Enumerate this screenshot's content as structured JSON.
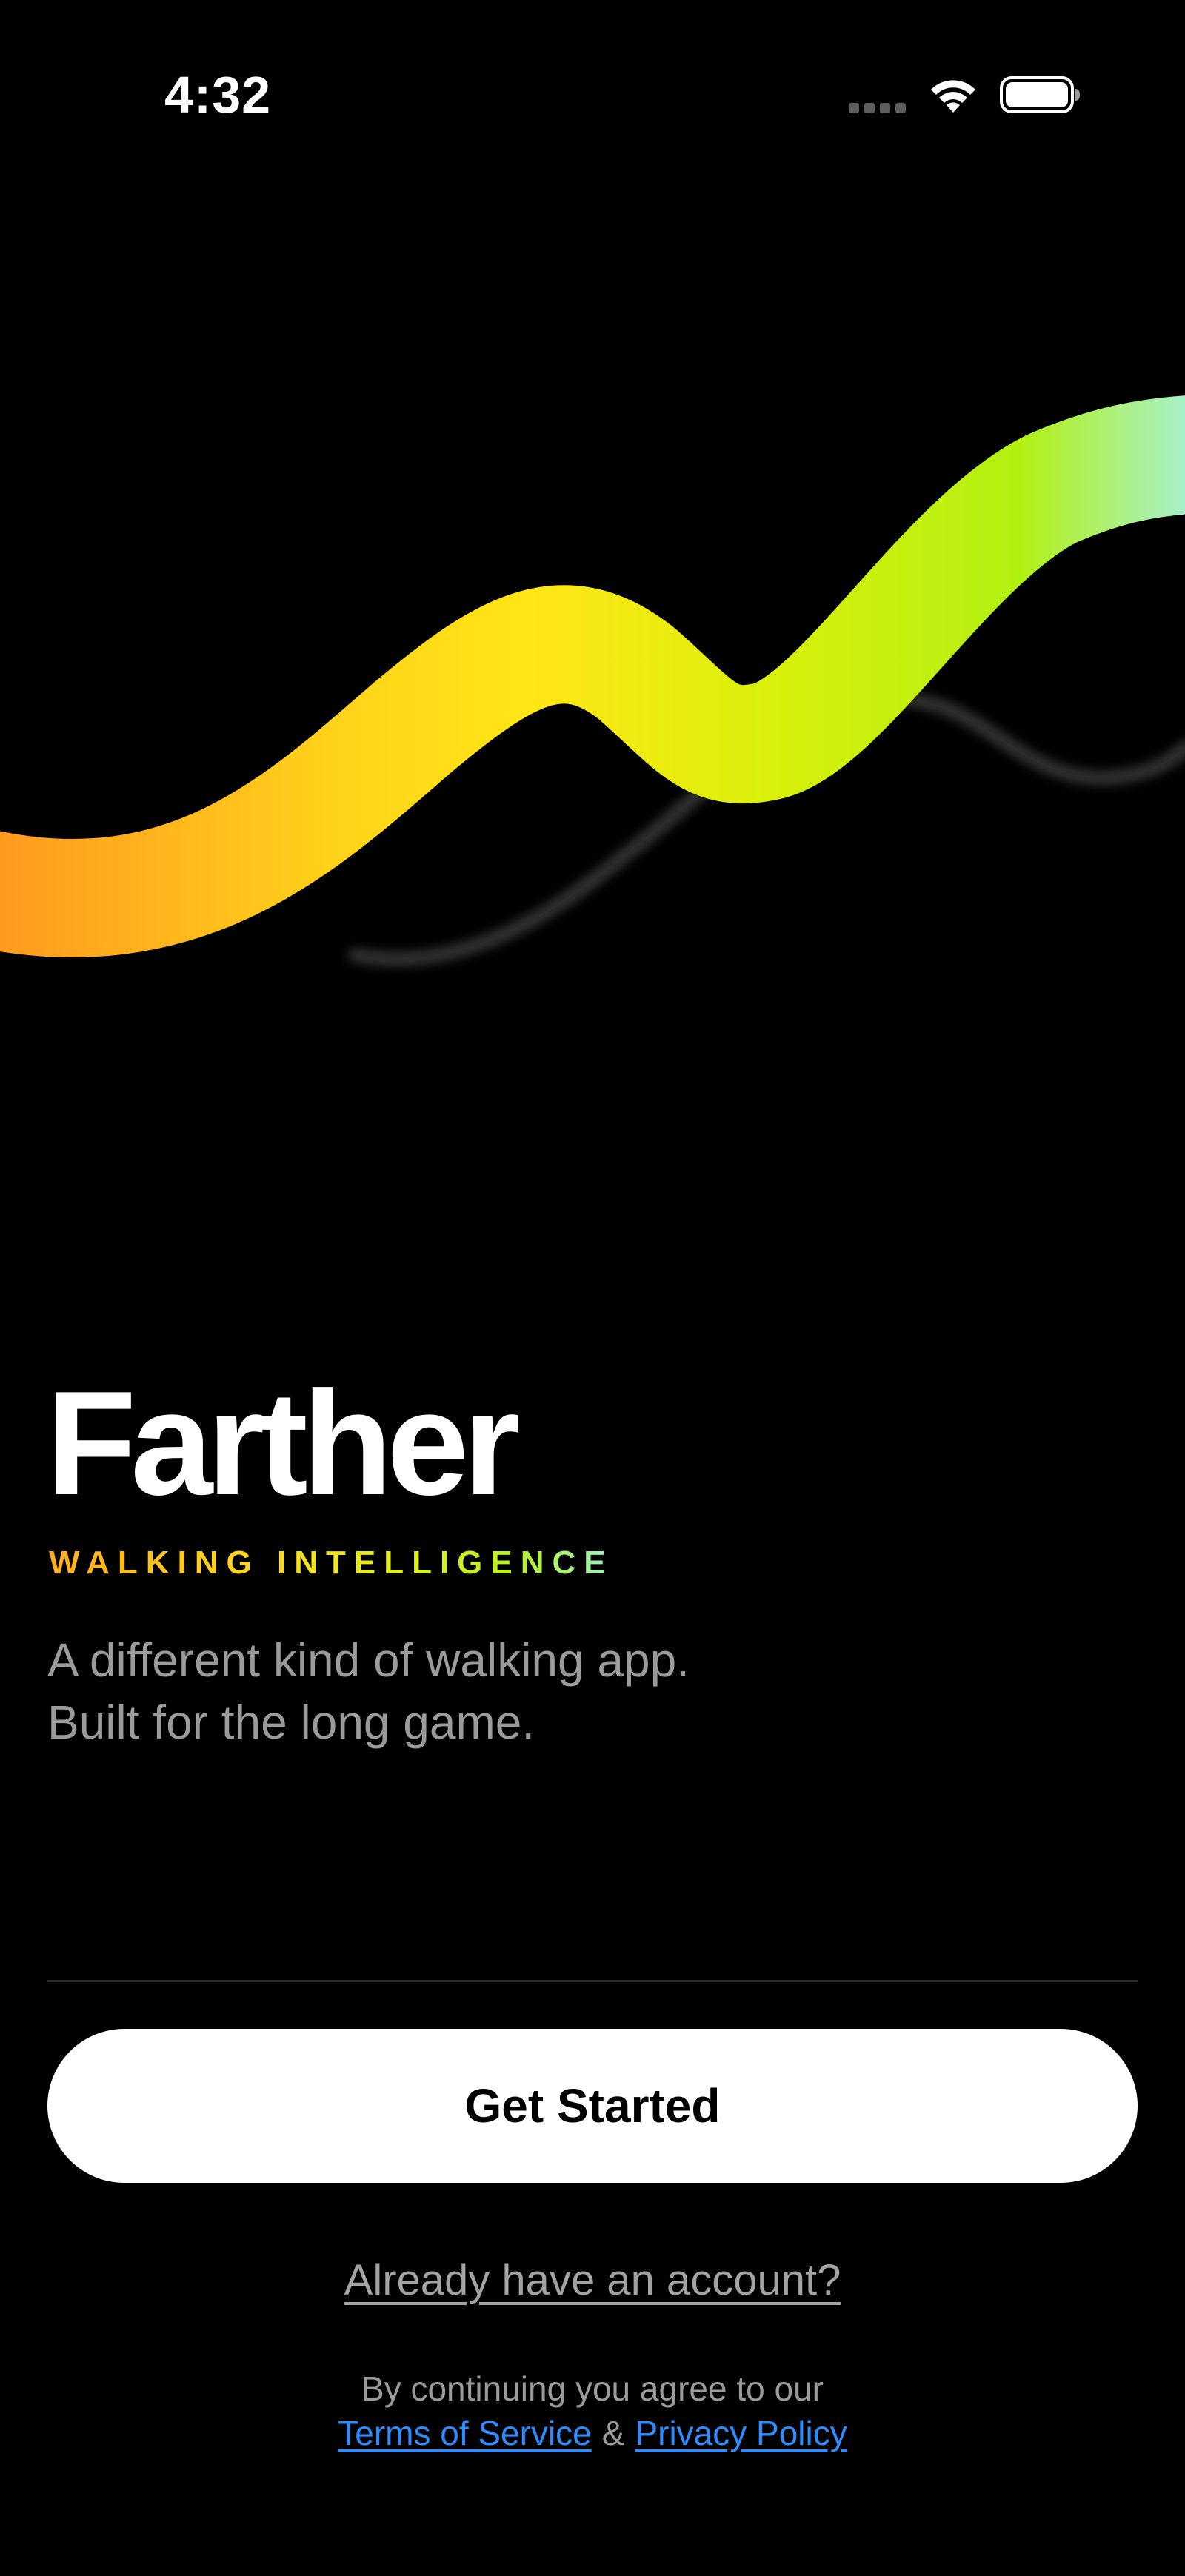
{
  "status_bar": {
    "time": "4:32",
    "icons": [
      "cellular-signal-icon",
      "wifi-icon",
      "battery-icon"
    ]
  },
  "hero": {
    "title": "Farther",
    "tagline": "WALKING INTELLIGENCE",
    "description_lines": [
      "A different kind of walking app.",
      "Built for the long game."
    ]
  },
  "actions": {
    "get_started_label": "Get Started",
    "signin_label": "Already have an account?"
  },
  "legal": {
    "prefix": "By continuing you agree to our",
    "terms_label": "Terms of Service",
    "ampersand": "&",
    "privacy_label": "Privacy Policy"
  },
  "colors": {
    "background": "#000000",
    "accent_link": "#2f8cff",
    "wave_gradient": [
      "#ff9a1f",
      "#ffd21a",
      "#ffe615",
      "#d9f00a",
      "#b2f012",
      "#a7f0c8"
    ]
  }
}
